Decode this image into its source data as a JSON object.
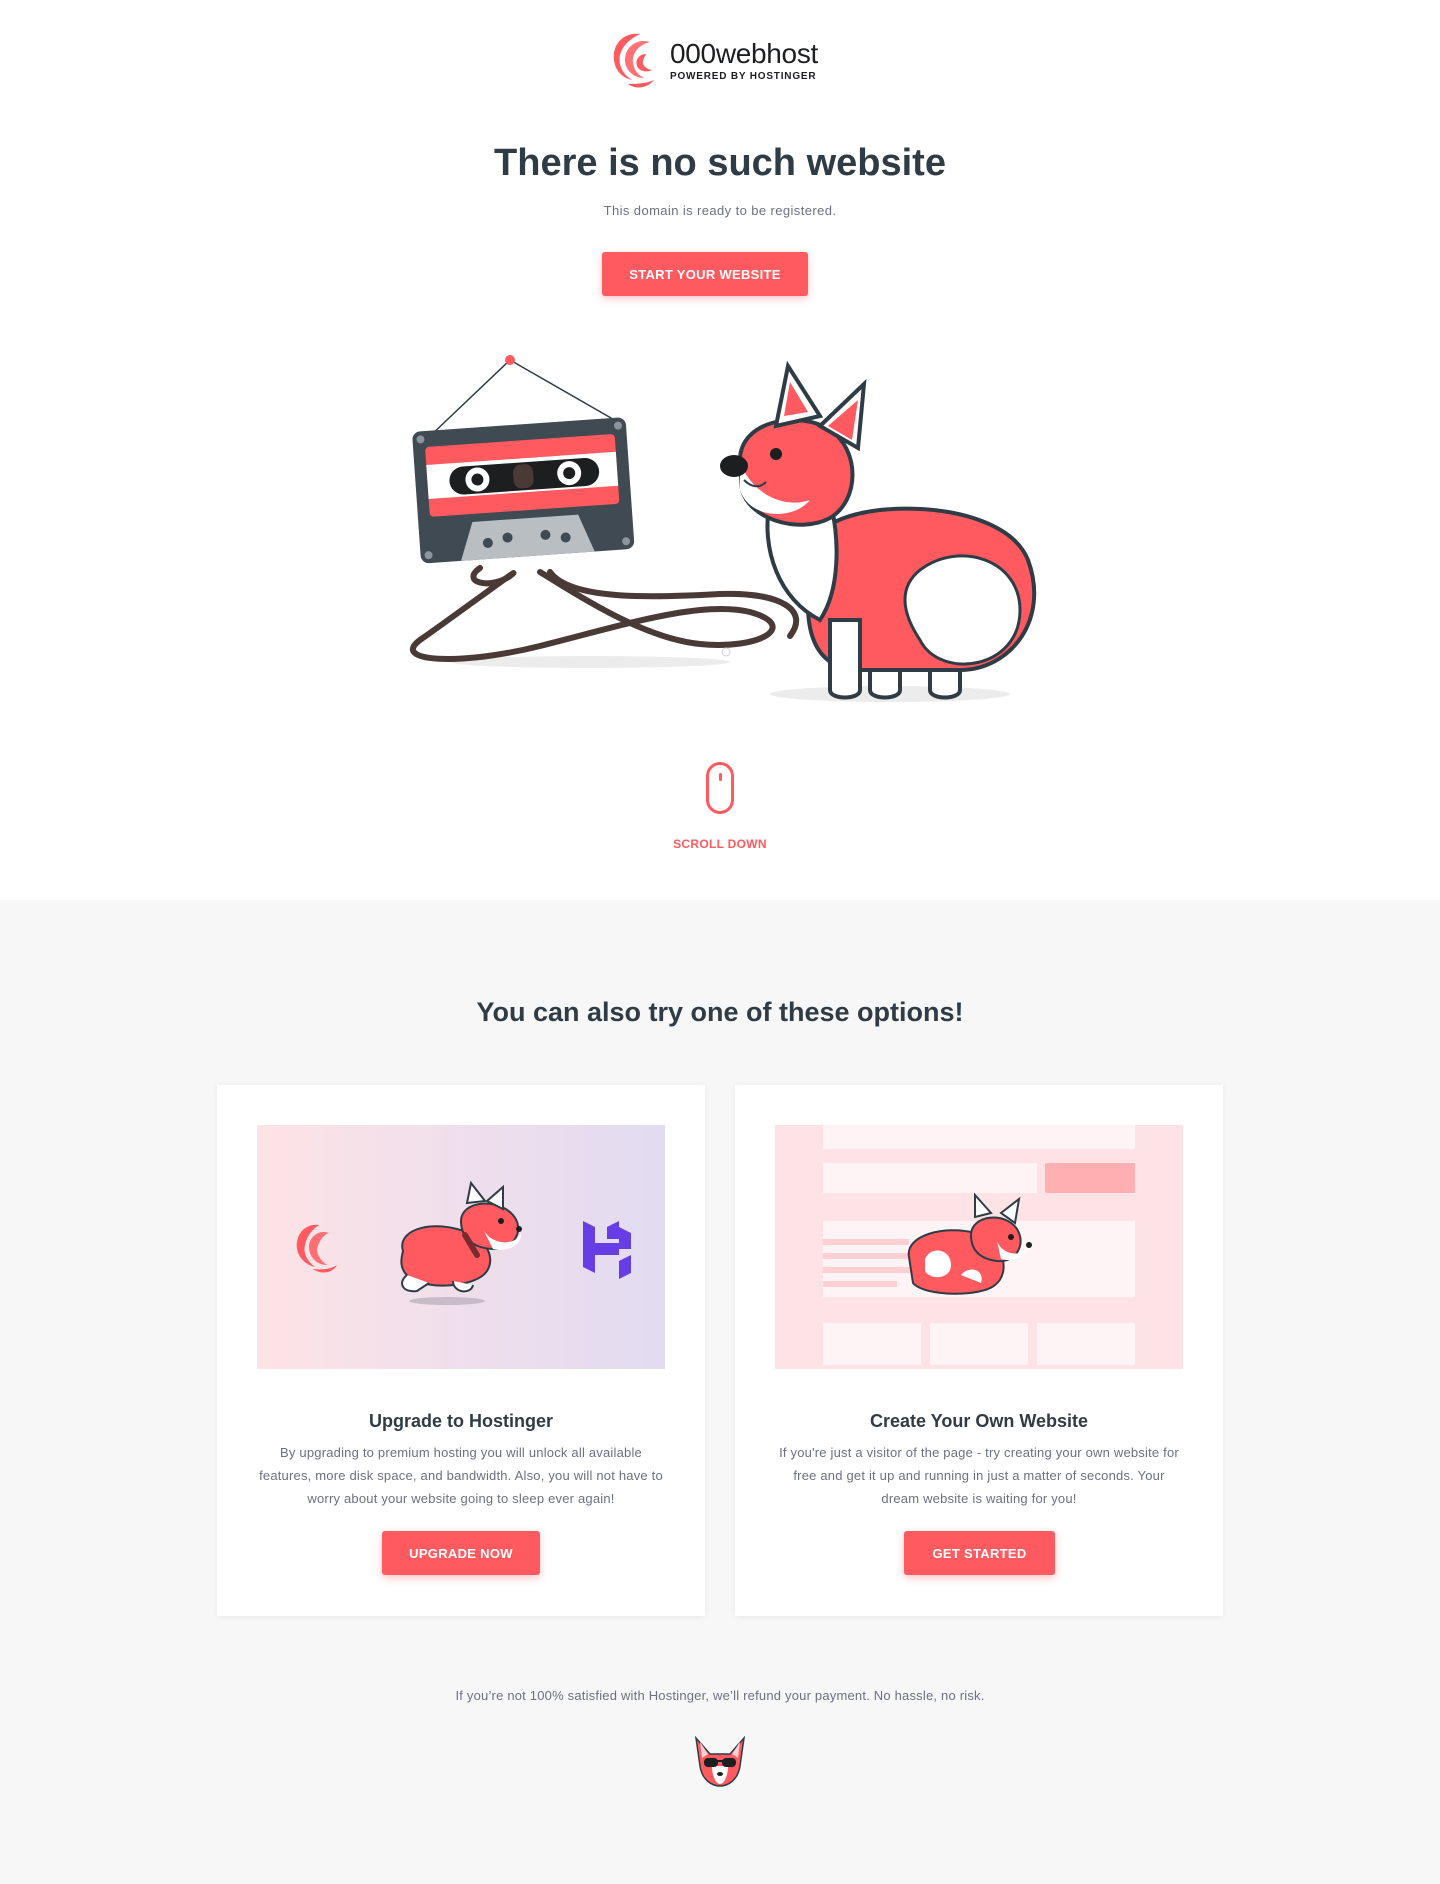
{
  "brand": {
    "name": "000webhost",
    "tagline": "POWERED BY HOSTINGER",
    "accent": "#ff5a5f",
    "dark": "#2f3c46"
  },
  "hero": {
    "title": "There is no such website",
    "subtitle": "This domain is ready to be registered.",
    "cta_label": "START YOUR WEBSITE"
  },
  "scroll": {
    "label": "SCROLL DOWN",
    "icon": "mouse-icon"
  },
  "options": {
    "title": "You can also try one of these options!",
    "cards": [
      {
        "title": "Upgrade to Hostinger",
        "text": "By upgrading to premium hosting you will unlock all available features, more disk space, and bandwidth. Also, you will not have to worry about your website going to sleep ever again!",
        "button": "UPGRADE NOW"
      },
      {
        "title": "Create Your Own Website",
        "text": "If you're just a visitor of the page - try creating your own website for free and get it up and running in just a matter of seconds. Your dream website is waiting for you!",
        "button": "GET STARTED"
      }
    ]
  },
  "footer": {
    "refund": "If you’re not 100% satisfied with Hostinger, we’ll refund your payment. No hassle, no risk."
  }
}
